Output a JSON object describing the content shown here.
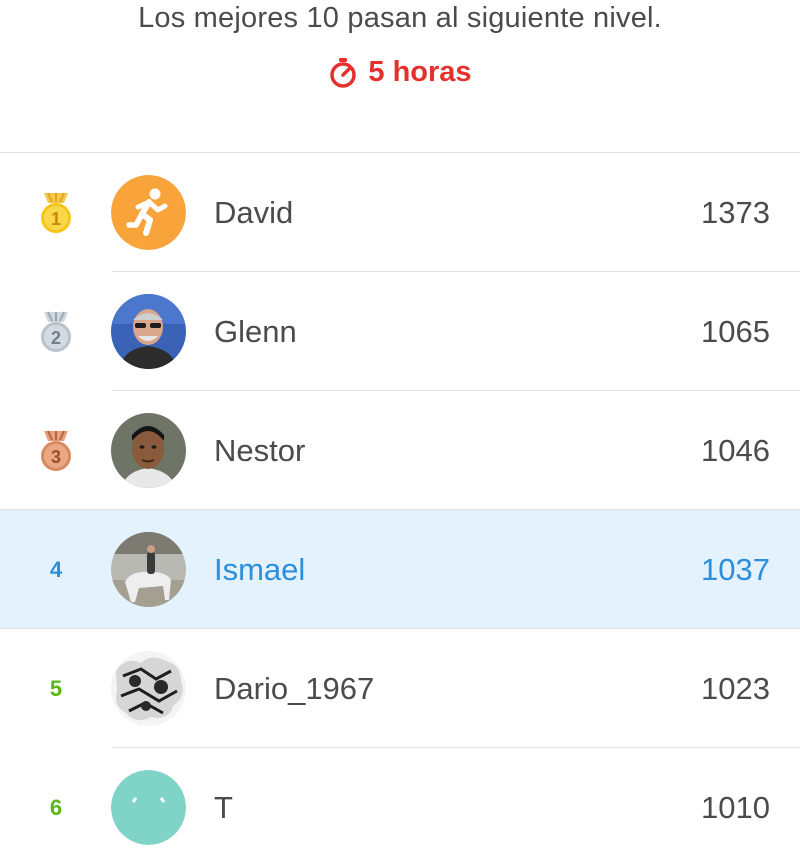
{
  "header": {
    "subtitle": "Los mejores 10 pasan al siguiente nivel.",
    "timer_label": "5 horas",
    "timer_color": "#e5312d"
  },
  "leaderboard": [
    {
      "rank": "1",
      "name": "David",
      "score": "1373",
      "avatar": "running-person-icon",
      "medal": "gold-medal-icon",
      "rank_color": "#f5c300"
    },
    {
      "rank": "2",
      "name": "Glenn",
      "score": "1065",
      "avatar": "photo-avatar",
      "medal": "silver-medal-icon",
      "rank_color": "#b9c3cc"
    },
    {
      "rank": "3",
      "name": "Nestor",
      "score": "1046",
      "avatar": "photo-avatar",
      "medal": "bronze-medal-icon",
      "rank_color": "#d9895e"
    },
    {
      "rank": "4",
      "name": "Ismael",
      "score": "1037",
      "avatar": "photo-avatar",
      "highlighted": true,
      "rank_color": "#2b8fdc"
    },
    {
      "rank": "5",
      "name": "Dario_1967",
      "score": "1023",
      "avatar": "photo-avatar",
      "rank_color": "#58b714"
    },
    {
      "rank": "6",
      "name": "T",
      "score": "1010",
      "avatar": "teal-avatar",
      "rank_color": "#58b714"
    }
  ],
  "colors": {
    "highlight_bg": "#e4f2fd",
    "highlight_text": "#2b8fdc",
    "promotion_green": "#58b714"
  }
}
